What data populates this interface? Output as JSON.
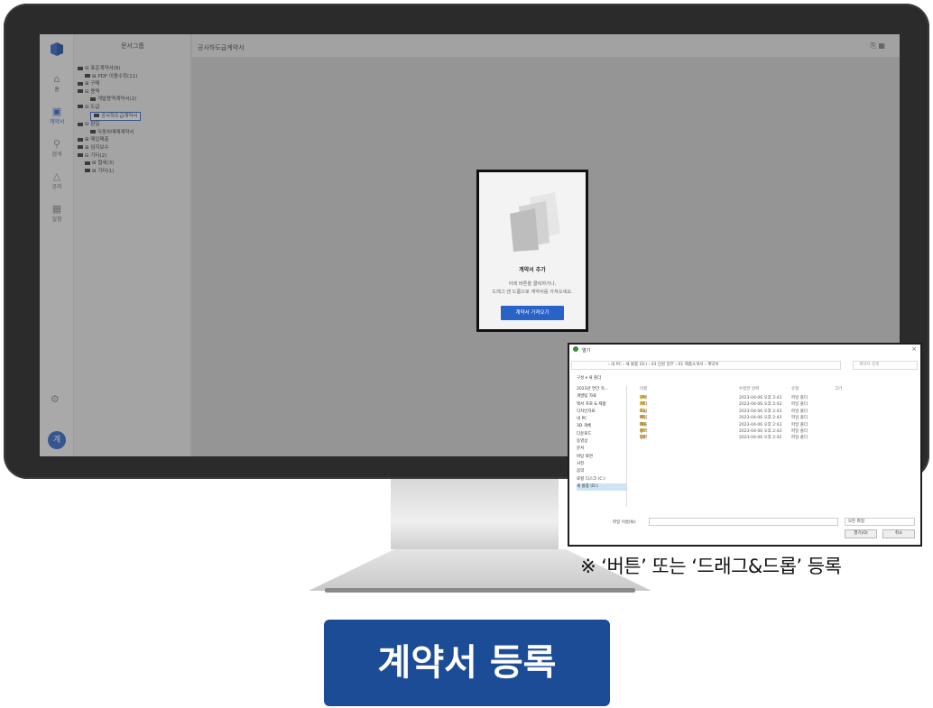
{
  "app": {
    "rail": [
      {
        "label": "홈",
        "icon": "home-icon"
      },
      {
        "label": "계약서",
        "icon": "contract-icon"
      },
      {
        "label": "검색",
        "icon": "search-icon"
      },
      {
        "label": "공지",
        "icon": "bell-icon"
      },
      {
        "label": "일정",
        "icon": "calendar-icon"
      }
    ],
    "avatar": "계",
    "sidebar_title": "문서그룹",
    "tree": [
      "⊟ 표준계약서(8)",
      "⊞ PDF 이용수정(11)",
      "⊞ 구매",
      "⊟ 용역",
      "개발용역계약서(2)",
      "⊟ 도급",
      "공사하도급계약서",
      "⊟ 판일",
      "자동차매매계약서",
      "⊞ 매입매출",
      "⊞ 임지보수",
      "⊟ 기타(2)",
      "⊞ 협세(3)",
      "⊞ 기타(1)"
    ],
    "header_title": "공사하도급계약서",
    "header_tools": "⎘ ▦"
  },
  "card": {
    "title": "계약서 추가",
    "desc_line1": "아래 버튼을 클릭하거나,",
    "desc_line2": "드래그 앤 드롭으로 계약서를 가져오세요.",
    "button": "계약서 가져오기"
  },
  "dialog": {
    "title": "열기",
    "path": "› 내 PC › 새 볼륨 (D:) › 03 민원 업무 › 01 제품소개서 › 계약서",
    "search_placeholder": "계약서 검색",
    "toolbar": "구성 ▾   새 폴더",
    "sidebar": [
      "2023년 연간 옥...",
      "개발팀 자료",
      "백서 프로 & 제품",
      "디자인자료",
      "내 PC",
      "3D 개체",
      "다운로드",
      "동영상",
      "문서",
      "바탕 화면",
      "사진",
      "음악",
      "로컬 디스크 (C:)",
      "새 볼륨 (D:)"
    ],
    "columns": {
      "name": "이름",
      "date": "수정한 날짜",
      "type": "유형",
      "size": "크기"
    },
    "rows": [
      {
        "name": "구매",
        "date": "2023-04-06 오후 2:43",
        "type": "파일 폴더"
      },
      {
        "name": "기타",
        "date": "2023-04-06 오후 2:43",
        "type": "파일 폴더"
      },
      {
        "name": "도급",
        "date": "2023-04-06 오후 2:43",
        "type": "파일 폴더"
      },
      {
        "name": "매입",
        "date": "2023-04-06 오후 2:43",
        "type": "파일 폴더"
      },
      {
        "name": "매출",
        "date": "2023-04-06 오후 2:43",
        "type": "파일 폴더"
      },
      {
        "name": "용역",
        "date": "2023-04-06 오후 2:43",
        "type": "파일 폴더"
      },
      {
        "name": "임판",
        "date": "2023-04-06 오후 2:42",
        "type": "파일 폴더"
      }
    ],
    "filename_label": "파일 이름(N):",
    "filter": "모든 파일",
    "open": "열기(O)",
    "cancel": "취소"
  },
  "note": "※ ‘버튼’ 또는 ‘드래그&드롭’ 등록",
  "cta": "계약서 등록",
  "colors": {
    "accent": "#2a63c8",
    "cta": "#1d4c96",
    "bezel": "#2b2b2b"
  }
}
